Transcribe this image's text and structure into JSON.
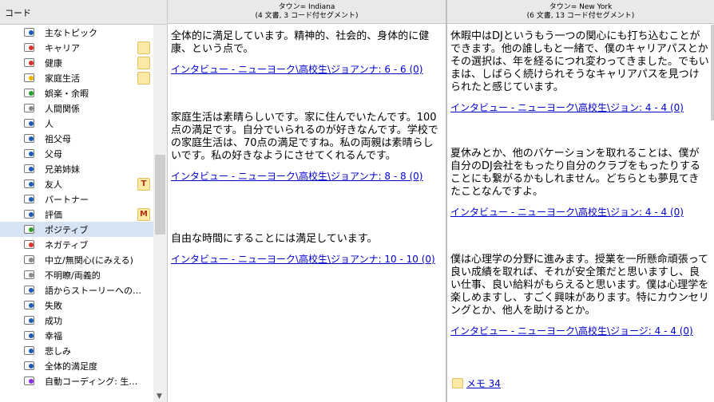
{
  "codes_header": "コード",
  "codes": [
    {
      "label": "主なトピック",
      "dot": "#1e5bb5",
      "badge": ""
    },
    {
      "label": "キャリア",
      "dot": "#d9342b",
      "badge": "memo"
    },
    {
      "label": "健康",
      "dot": "#d9342b",
      "badge": "memo"
    },
    {
      "label": "家庭生活",
      "dot": "#f0b400",
      "badge": "memo"
    },
    {
      "label": "娯楽・余暇",
      "dot": "#2ca02c",
      "badge": ""
    },
    {
      "label": "人間関係",
      "dot": "#888888",
      "badge": ""
    },
    {
      "label": "人",
      "dot": "#1e5bb5",
      "badge": ""
    },
    {
      "label": "祖父母",
      "dot": "#1e5bb5",
      "badge": ""
    },
    {
      "label": "父母",
      "dot": "#1e5bb5",
      "badge": ""
    },
    {
      "label": "兄弟姉妹",
      "dot": "#1e5bb5",
      "badge": ""
    },
    {
      "label": "友人",
      "dot": "#1e5bb5",
      "badge": "T"
    },
    {
      "label": "パートナー",
      "dot": "#1e5bb5",
      "badge": ""
    },
    {
      "label": "評価",
      "dot": "#1e5bb5",
      "badge": "M"
    },
    {
      "label": "ポジティブ",
      "dot": "#2ca02c",
      "badge": "",
      "selected": true
    },
    {
      "label": "ネガティブ",
      "dot": "#d9342b",
      "badge": ""
    },
    {
      "label": "中立/無関心(にみえる)",
      "dot": "#888888",
      "badge": ""
    },
    {
      "label": "不明瞭/両義的",
      "dot": "#888888",
      "badge": ""
    },
    {
      "label": "語からストーリーへの…",
      "dot": "#1e5bb5",
      "badge": ""
    },
    {
      "label": "失敗",
      "dot": "#1e5bb5",
      "badge": ""
    },
    {
      "label": "成功",
      "dot": "#1e5bb5",
      "badge": ""
    },
    {
      "label": "幸福",
      "dot": "#1e5bb5",
      "badge": ""
    },
    {
      "label": "悲しみ",
      "dot": "#1e5bb5",
      "badge": ""
    },
    {
      "label": "全体的満足度",
      "dot": "#1e5bb5",
      "badge": ""
    },
    {
      "label": "自動コーディング: 生…",
      "dot": "#8a2be2",
      "badge": ""
    }
  ],
  "columns": [
    {
      "title": "タウン= Indiana",
      "subtitle": "(4 文書, 3 コード付セグメント)",
      "segments": [
        {
          "text": "全体的に満足しています。精神的、社会的、身体的に健康、という点で。",
          "link": "インタビュー - ニューヨーク\\高校生\\ジョアンナ: 6 - 6 (0)"
        },
        {
          "text": "家庭生活は素晴らしいです。家に住んでいたんです。100点の満足です。自分でいられるのが好きなんです。学校での家庭生活は、70点の満足ですね。私の両親は素晴らしいです。私の好きなようにさせてくれるんです。",
          "link": "インタビュー - ニューヨーク\\高校生\\ジョアンナ: 8 - 8 (0)"
        },
        {
          "text": "自由な時間にすることには満足しています。",
          "link": "インタビュー - ニューヨーク\\高校生\\ジョアンナ: 10 - 10 (0)"
        }
      ]
    },
    {
      "title": "タウン= New York",
      "subtitle": "(6 文書, 13 コード付セグメント)",
      "segments": [
        {
          "text": "休暇中はDJというもう一つの関心にも打ち込むことができます。他の誰しもと一緒で、僕のキャリアパスとかその選択は、年を経るにつれ変わってきました。でもいまは、しばらく続けられそうなキャリアパスを見つけられたと感じています。",
          "link": "インタビュー - ニューヨーク\\高校生\\ジョン: 4 - 4 (0)"
        },
        {
          "text": "夏休みとか、他のバケーションを取れることは、僕が自分のDJ会社をもったり自分のクラブをもったりすることにも繋がるかもしれません。どちらとも夢見てきたことなんですよ。",
          "link": "インタビュー - ニューヨーク\\高校生\\ジョン: 4 - 4 (0)"
        },
        {
          "text": "僕は心理学の分野に進みます。授業を一所懸命頑張って良い成績を取れば、それが安全策だと思いますし、良い仕事、良い給料がもらえると思います。僕は心理学を楽しめますし、すごく興味があります。特にカウンセリングとか、他人を助けるとか。",
          "link": "インタビュー - ニューヨーク\\高校生\\ジョージ: 4 - 4 (0)"
        }
      ],
      "memo_label": "メモ 34"
    }
  ]
}
